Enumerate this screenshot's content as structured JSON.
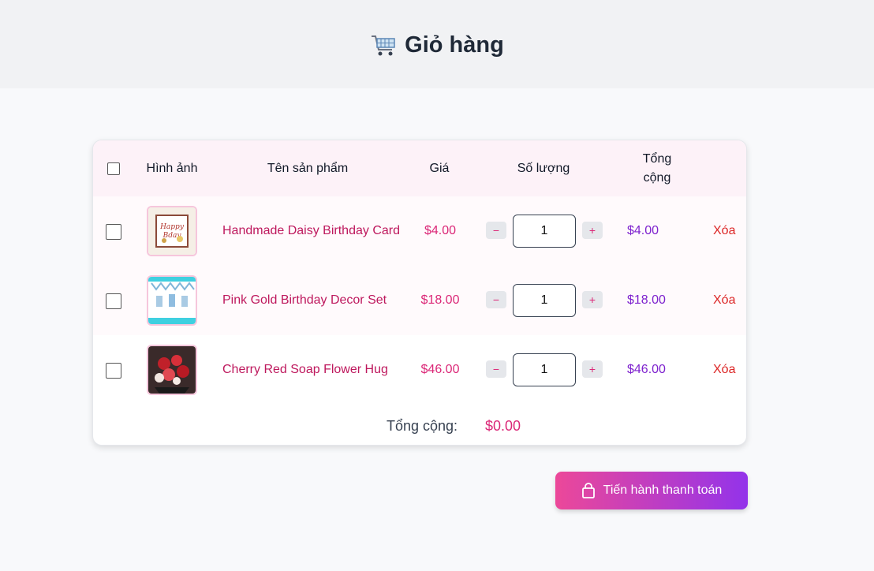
{
  "header": {
    "title": "Giỏ hàng",
    "icon": "shopping-cart-icon"
  },
  "table": {
    "columns": {
      "image": "Hình ảnh",
      "name": "Tên sản phẩm",
      "price": "Giá",
      "quantity": "Số lượng",
      "total": "Tổng cộng"
    },
    "rows": [
      {
        "name": "Handmade Daisy Birthday Card",
        "price": "$4.00",
        "qty": "1",
        "total": "$4.00",
        "delete": "Xóa",
        "minus": "−",
        "plus": "+"
      },
      {
        "name": "Pink Gold Birthday Decor Set",
        "price": "$18.00",
        "qty": "1",
        "total": "$18.00",
        "delete": "Xóa",
        "minus": "−",
        "plus": "+"
      },
      {
        "name": "Cherry Red Soap Flower Hug",
        "price": "$46.00",
        "qty": "1",
        "total": "$46.00",
        "delete": "Xóa",
        "minus": "−",
        "plus": "+"
      }
    ],
    "grand_total_label": "Tổng cộng:",
    "grand_total_value": "$0.00"
  },
  "checkout": {
    "label": "Tiến hành thanh toán",
    "icon": "shopping-bag-icon"
  },
  "colors": {
    "accent_pink": "#db2777",
    "accent_purple": "#7e22ce",
    "delete_red": "#dc2626",
    "button_gradient_start": "#ec4899",
    "button_gradient_end": "#9333ea"
  }
}
